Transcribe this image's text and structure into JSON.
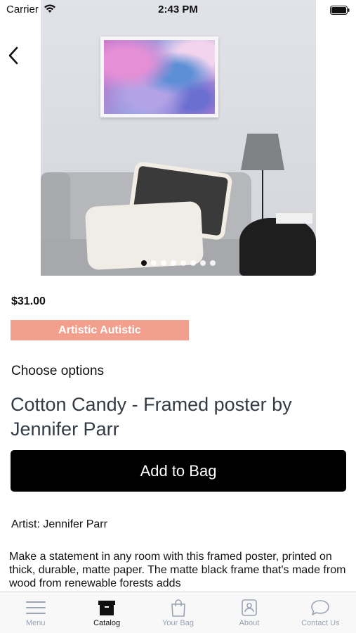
{
  "status_bar": {
    "carrier": "Carrier",
    "time": "2:43 PM"
  },
  "product": {
    "price": "$31.00",
    "vendor": "Artistic Autistic",
    "choose_options": "Choose options",
    "title": "Cotton Candy - Framed poster by Jennifer Parr",
    "add_to_bag": "Add to Bag",
    "artist": "Artist: Jennifer Parr",
    "description": "Make a statement in any room with this framed poster, printed on thick, durable, matte paper. The matte black frame that's made from wood from renewable forests adds"
  },
  "gallery": {
    "image_count": 8,
    "active_index": 0
  },
  "tabs": [
    {
      "label": "Menu",
      "icon": "menu-icon"
    },
    {
      "label": "Catalog",
      "icon": "catalog-icon",
      "active": true
    },
    {
      "label": "Your Bag",
      "icon": "bag-icon"
    },
    {
      "label": "About",
      "icon": "about-icon"
    },
    {
      "label": "Contact Us",
      "icon": "chat-icon"
    }
  ],
  "colors": {
    "badge_bg": "#f2a08d",
    "button_bg": "#000000",
    "tab_inactive": "#9aa3b3",
    "tab_active": "#111111"
  }
}
